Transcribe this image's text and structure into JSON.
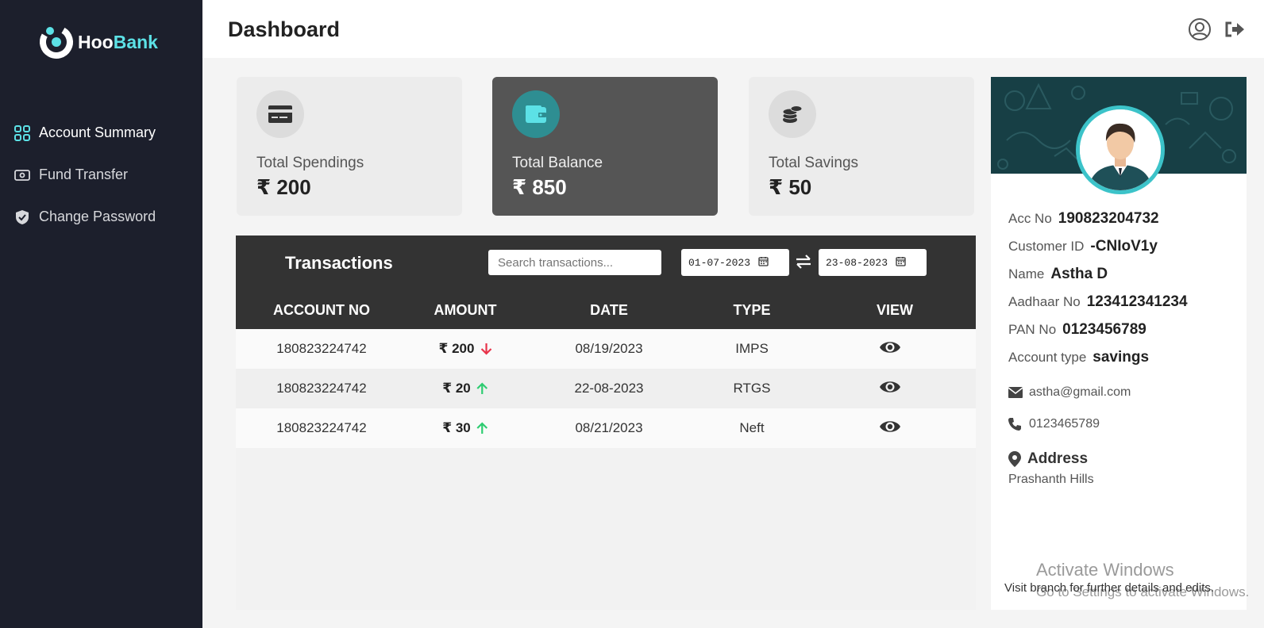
{
  "brand": {
    "name_part1": "Hoo",
    "name_part2": "Bank",
    "accent": "#5ce1e6"
  },
  "sidebar": {
    "items": [
      {
        "label": "Account Summary",
        "icon": "grid-icon",
        "active": true
      },
      {
        "label": "Fund Transfer",
        "icon": "cash-icon"
      },
      {
        "label": "Change Password",
        "icon": "shield-icon"
      }
    ]
  },
  "header": {
    "title": "Dashboard",
    "icons": [
      "user-circle-icon",
      "logout-icon"
    ]
  },
  "cards": [
    {
      "label": "Total Spendings",
      "value": "₹ 200",
      "icon": "credit-card-icon"
    },
    {
      "label": "Total Balance",
      "value": "₹ 850",
      "icon": "wallet-icon"
    },
    {
      "label": "Total Savings",
      "value": "₹ 50",
      "icon": "coins-icon"
    }
  ],
  "transactions": {
    "title": "Transactions",
    "search_placeholder": "Search transactions...",
    "from_date": "01-07-2023",
    "to_date": "23-08-2023",
    "columns": [
      "ACCOUNT NO",
      "AMOUNT",
      "DATE",
      "TYPE",
      "VIEW"
    ],
    "rows": [
      {
        "account": "180823224742",
        "amount": "₹ 200",
        "direction": "down",
        "date": "08/19/2023",
        "type": "IMPS"
      },
      {
        "account": "180823224742",
        "amount": "₹ 20",
        "direction": "up",
        "date": "22-08-2023",
        "type": "RTGS"
      },
      {
        "account": "180823224742",
        "amount": "₹ 30",
        "direction": "up",
        "date": "08/21/2023",
        "type": "Neft"
      }
    ],
    "colors": {
      "down": "#e8334a",
      "up": "#2ecc71"
    }
  },
  "profile": {
    "fields": [
      {
        "label": "Acc No",
        "value": "190823204732"
      },
      {
        "label": "Customer ID",
        "value": "-CNIoV1y"
      },
      {
        "label": "Name",
        "value": "Astha D"
      },
      {
        "label": "Aadhaar No",
        "value": "123412341234"
      },
      {
        "label": "PAN No",
        "value": "0123456789"
      },
      {
        "label": "Account type",
        "value": "savings"
      }
    ],
    "email": "astha@gmail.com",
    "phone": "0123465789",
    "address_label": "Address",
    "address": "Prashanth Hills"
  },
  "watermark": {
    "line1": "Activate Windows",
    "line2": "Go to Settings to activate Windows.",
    "hint": "Visit branch for further details and edits."
  }
}
